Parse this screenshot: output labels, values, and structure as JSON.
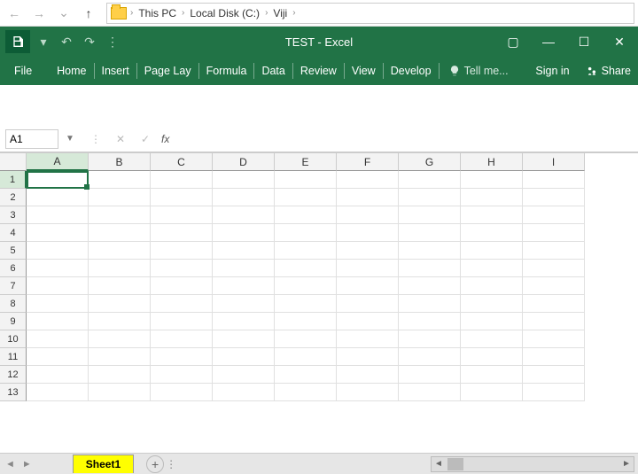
{
  "explorer": {
    "crumbs": [
      "This PC",
      "Local Disk (C:)",
      "Viji"
    ]
  },
  "app": {
    "title": "TEST - Excel"
  },
  "ribbon": {
    "file": "File",
    "tabs": [
      "Home",
      "Insert",
      "Page Lay",
      "Formula",
      "Data",
      "Review",
      "View",
      "Develop"
    ],
    "tellme": "Tell me...",
    "signin": "Sign in",
    "share": "Share"
  },
  "formula_bar": {
    "name_box": "A1",
    "fx": "fx"
  },
  "grid": {
    "columns": [
      "A",
      "B",
      "C",
      "D",
      "E",
      "F",
      "G",
      "H",
      "I"
    ],
    "rows": [
      "1",
      "2",
      "3",
      "4",
      "5",
      "6",
      "7",
      "8",
      "9",
      "10",
      "11",
      "12",
      "13"
    ],
    "active_cell": "A1"
  },
  "sheets": {
    "active": "Sheet1"
  }
}
